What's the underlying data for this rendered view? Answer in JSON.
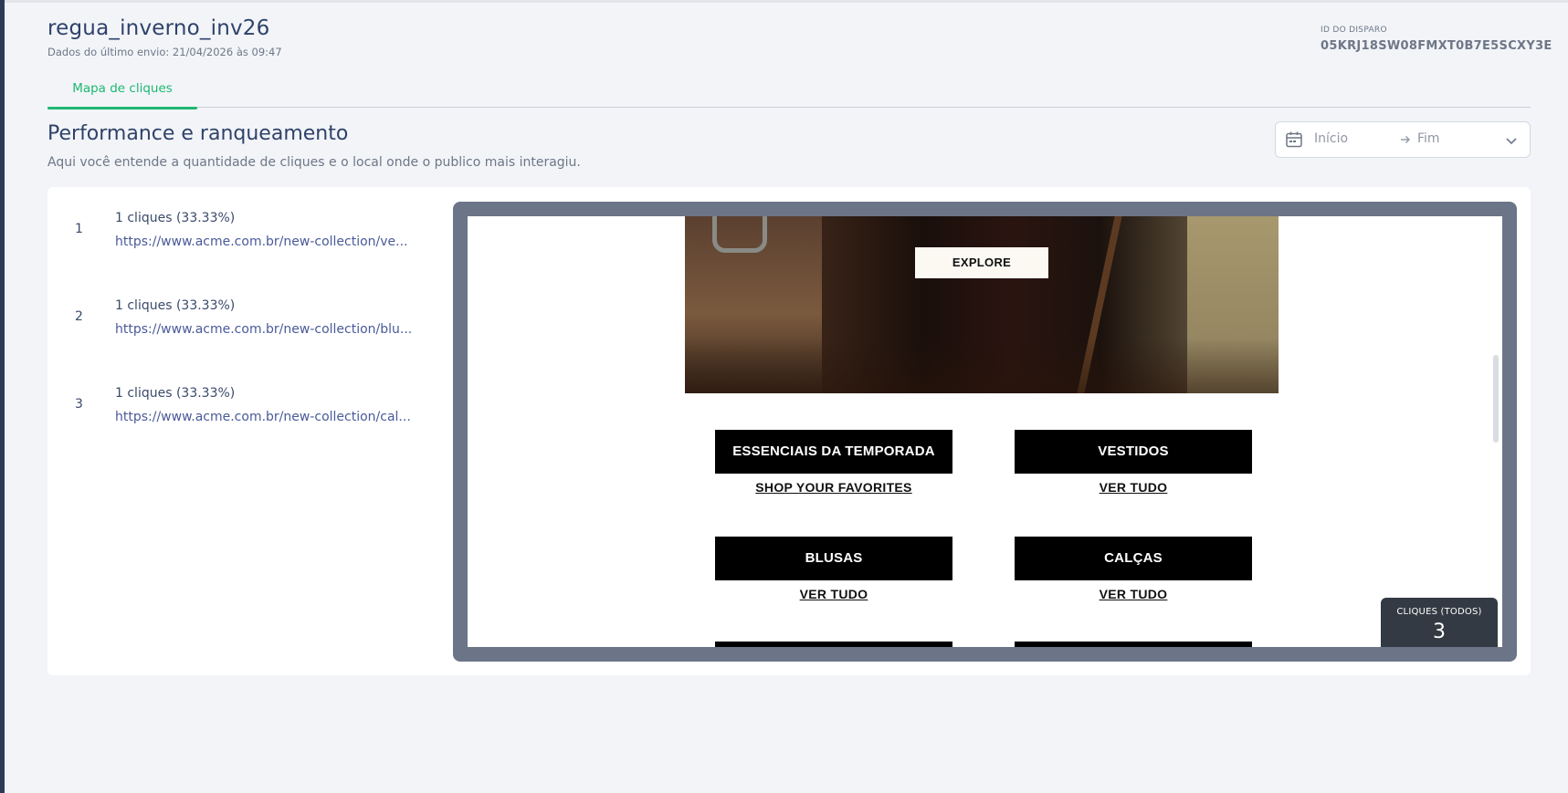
{
  "header": {
    "title": "regua_inverno_inv26",
    "subtitle": "Dados do último envio: 21/04/2026 às 09:47",
    "send_id_label": "ID DO DISPARO",
    "send_id_value": "05KRJ18SW08FMXT0B7E5SCXY3E"
  },
  "tabs": [
    {
      "label": "Mapa de cliques",
      "active": true
    }
  ],
  "section": {
    "title": "Performance e ranqueamento",
    "description": "Aqui você entende a quantidade de cliques e o local onde o publico mais interagiu."
  },
  "date_range": {
    "start_placeholder": "Início",
    "end_placeholder": "Fim",
    "icons": [
      "calendar-icon",
      "arrow-right-icon",
      "chevron-down-icon"
    ]
  },
  "ranking": [
    {
      "index": "1",
      "clicks": "1 cliques (33.33%)",
      "url": "https://www.acme.com.br/new-collection/ve..."
    },
    {
      "index": "2",
      "clicks": "1 cliques (33.33%)",
      "url": "https://www.acme.com.br/new-collection/blu..."
    },
    {
      "index": "3",
      "clicks": "1 cliques (33.33%)",
      "url": "https://www.acme.com.br/new-collection/cal..."
    }
  ],
  "email_preview": {
    "explore_label": "EXPLORE",
    "categories": [
      {
        "title": "ESSENCIAIS DA TEMPORADA",
        "link": "SHOP YOUR FAVORITES"
      },
      {
        "title": "VESTIDOS",
        "link": "VER TUDO"
      },
      {
        "title": "BLUSAS",
        "link": "VER TUDO"
      },
      {
        "title": "CALÇAS",
        "link": "VER TUDO"
      }
    ]
  },
  "clicks_badge": {
    "label": "CLIQUES (TODOS)",
    "value": "3"
  },
  "colors": {
    "accent": "#1fb871",
    "title": "#2f426a",
    "link": "#4a5a99",
    "preview_frame": "#6b7587",
    "badge": "#343a43",
    "rail": "#2c3a57"
  }
}
